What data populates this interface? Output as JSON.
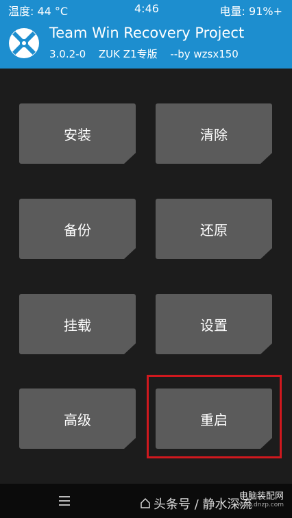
{
  "status_bar": {
    "temperature": "温度: 44 °C",
    "time": "4:46",
    "battery": "电量: 91%+"
  },
  "header": {
    "logo_icon": "twrp-logo-icon",
    "title": "Team Win Recovery Project",
    "version": "3.0.2-0",
    "device": "ZUK Z1专版",
    "author": "--by wzsx150"
  },
  "menu": {
    "install": "安装",
    "wipe": "清除",
    "backup": "备份",
    "restore": "还原",
    "mount": "挂载",
    "settings": "设置",
    "advanced": "高级",
    "reboot": "重启"
  },
  "nav_bar": {
    "menu_icon": "menu-icon"
  },
  "watermark": {
    "text": "头条号 / 静水深流",
    "site": "电脑装配网",
    "site_url": "www.dnzp.com"
  },
  "colors": {
    "header_bg": "#1d8ecf",
    "screen_bg": "#1c1c1c",
    "tile_bg": "#5b5b5b",
    "highlight": "#d0181e"
  }
}
